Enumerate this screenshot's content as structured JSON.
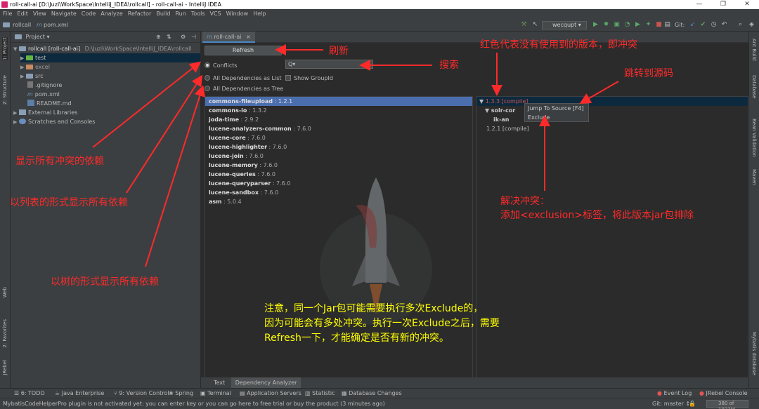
{
  "window": {
    "title": "roll-call-ai [D:\\Juzi\\WorkSpace\\IntelliJ_IDEA\\rollcall] - roll-call-ai - IntelliJ IDEA"
  },
  "menu": [
    "File",
    "Edit",
    "View",
    "Navigate",
    "Code",
    "Analyze",
    "Refactor",
    "Build",
    "Run",
    "Tools",
    "VCS",
    "Window",
    "Help"
  ],
  "navbar": {
    "project": "rollcall",
    "file": "pom.xml",
    "run_config": "wecqupt",
    "git_label": "Git:"
  },
  "project_panel": {
    "title": "Project",
    "items": [
      {
        "label": "rollcall [roll-call-ai]",
        "path": "D:\\Juzi\\WorkSpace\\IntelliJ_IDEA\\rollcall"
      },
      {
        "label": "test"
      },
      {
        "label": "excel"
      },
      {
        "label": "src"
      },
      {
        "label": ".gitignore"
      },
      {
        "label": "pom.xml"
      },
      {
        "label": "README.md"
      },
      {
        "label": "External Libraries"
      },
      {
        "label": "Scratches and Consoles"
      }
    ]
  },
  "left_stripe": {
    "project": "1: Project",
    "structure": "Z: Structure",
    "web": "Web",
    "favorites": "2: Favorites",
    "jrebel": "JRebel"
  },
  "right_stripe": {
    "ant": "Ant Build",
    "database": "Database",
    "bean": "Bean Validation",
    "maven": "Maven",
    "mybatis": "Mybatis database"
  },
  "editor": {
    "tab": "roll-call-ai",
    "refresh": "Refresh",
    "radios": [
      "Conflicts",
      "All Dependencies as List",
      "All Dependencies as Tree"
    ],
    "search_placeholder": "Q▾",
    "show_groupid": "Show GroupId",
    "dependencies": [
      {
        "name": "commons-fileupload",
        "version": " : 1.2.1"
      },
      {
        "name": "commons-io",
        "version": " : 1.3.2"
      },
      {
        "name": "joda-time",
        "version": " : 2.9.2"
      },
      {
        "name": "lucene-analyzers-common",
        "version": " : 7.6.0"
      },
      {
        "name": "lucene-core",
        "version": " : 7.6.0"
      },
      {
        "name": "lucene-highlighter",
        "version": " : 7.6.0"
      },
      {
        "name": "lucene-join",
        "version": " : 7.6.0"
      },
      {
        "name": "lucene-memory",
        "version": " : 7.6.0"
      },
      {
        "name": "lucene-queries",
        "version": " : 7.6.0"
      },
      {
        "name": "lucene-queryparser",
        "version": " : 7.6.0"
      },
      {
        "name": "lucene-sandbox",
        "version": " : 7.6.0"
      },
      {
        "name": "asm",
        "version": " : 5.0.4"
      }
    ],
    "tree": [
      "1.3.3 [compile]",
      "solr-cor",
      "ik-an",
      "1.2.1 [compile]"
    ],
    "popup": [
      "Jump To Source [F4]",
      "Exclude"
    ],
    "bottom_tabs": [
      "Text",
      "Dependency Analyzer"
    ]
  },
  "tool_windows": [
    "6: TODO",
    "Java Enterprise",
    "9: Version Control",
    "Spring",
    "Terminal",
    "Application Servers",
    "Statistic",
    "Database Changes",
    "Event Log",
    "JRebel Console"
  ],
  "status": {
    "message": "MybatisCodeHelperPro plugin is not activated yet: you can enter key or you can go here to free trial or buy the product (3 minutes ago)",
    "git": "Git: master ↕",
    "memory": "380 of 1933M"
  },
  "annotations": {
    "refresh": "刷新",
    "search": "搜索",
    "red_meaning": "红色代表没有使用到的版本，即冲突",
    "jump": "跳转到源码",
    "conflicts": "显示所有冲突的依赖",
    "as_list": "以列表的形式显示所有依赖",
    "as_tree": "以树的形式显示所有依赖",
    "resolve_1": "解决冲突：",
    "resolve_2": "添加<exclusion>标签，将此版本jar包排除",
    "note_1": "注意，同一个Jar包可能需要执行多次Exclude的，",
    "note_2": "因为可能会有多处冲突。执行一次Exclude之后，需要",
    "note_3": "Refresh一下，才能确定是否有新的冲突。"
  },
  "colors": {
    "annotation_red": "#ff2a2a",
    "annotation_yellow": "#ffff00",
    "selection": "#4b6eaf",
    "conflict_red": "#c75450"
  }
}
